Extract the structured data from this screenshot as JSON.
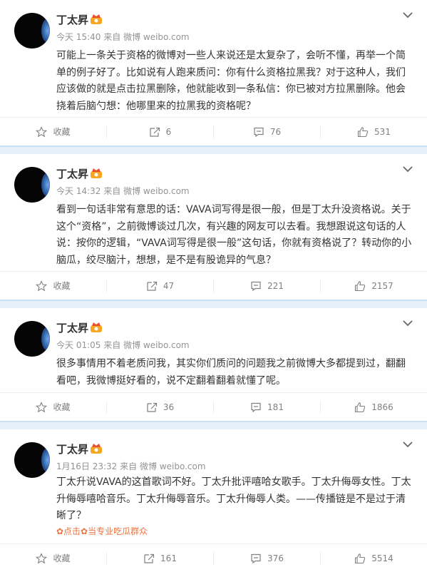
{
  "posts": [
    {
      "name": "丁太昇",
      "time": "今天 15:40",
      "source_prefix": "来自",
      "source": "微博 weibo.com",
      "lines": [
        "可能上一条关于资格的微博对一些人来说还是太复杂了，会听不懂，再举一个简",
        "单的例子好了。比如说有人跑来质问：你有什么资格拉黑我？对于这种人，我们",
        "应该做的就是点击拉黑删除，他就能收到一条私信：你已被对方拉黑删除。他会",
        "挠着后脑勺想：他哪里来的拉黑我的资格呢？"
      ],
      "tag": "",
      "actions": {
        "favorite": "收藏",
        "repost": "6",
        "comment": "76",
        "like": "531"
      }
    },
    {
      "name": "丁太昇",
      "time": "今天 14:32",
      "source_prefix": "来自",
      "source": "微博 weibo.com",
      "lines": [
        "看到一句话非常有意思的话：VAVA词写得是很一般，但是丁太升没资格说。关于",
        "这个“资格”，之前微博谈过几次，有兴趣的网友可以去看。我想跟说这句话的人",
        "说：按你的逻辑，“VAVA词写得是很一般”这句话，你就有资格说了？转动你的小",
        "脑瓜，绞尽脑汁，想想，是不是有股诡异的气息？"
      ],
      "tag": "",
      "actions": {
        "favorite": "收藏",
        "repost": "47",
        "comment": "221",
        "like": "2157"
      }
    },
    {
      "name": "丁太昇",
      "time": "今天 01:05",
      "source_prefix": "来自",
      "source": "微博 weibo.com",
      "lines": [
        "很多事情用不着老质问我，其实你们质问的问题我之前微博大多都提到过，翻翻",
        "看吧，我微博挺好看的，说不定翻着翻着就懂了呢。"
      ],
      "tag": "",
      "actions": {
        "favorite": "收藏",
        "repost": "36",
        "comment": "181",
        "like": "1866"
      }
    },
    {
      "name": "丁太昇",
      "time": "1月16日 23:32",
      "source_prefix": "来自",
      "source": "微博 weibo.com",
      "lines": [
        "丁太升说VAVA的这首歌词不好。丁太升批评嘻哈女歌手。丁太升侮辱女性。丁太",
        "升侮辱嘻哈音乐。丁太升侮辱音乐。丁太升侮辱人类。——传播链是不是过于清",
        "晰了？"
      ],
      "tag": "✿点击✿当专业吃瓜群众",
      "actions": {
        "favorite": "收藏",
        "repost": "161",
        "comment": "376",
        "like": "5514"
      }
    }
  ]
}
